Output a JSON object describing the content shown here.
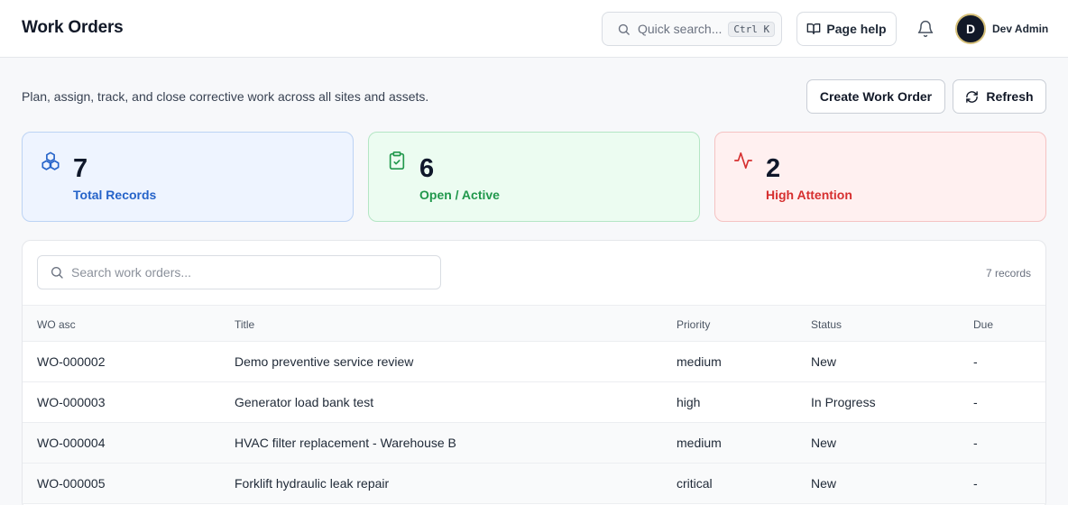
{
  "header": {
    "title": "Work Orders",
    "quick_search": {
      "placeholder": "Quick search...",
      "shortcut": "Ctrl K",
      "icon": "search-icon"
    },
    "help_label": "Page help",
    "help_icon": "book-open-icon",
    "notifications_icon": "bell-icon",
    "user": {
      "initial": "D",
      "name": "Dev Admin"
    }
  },
  "page": {
    "subtitle": "Plan, assign, track, and close corrective work across all sites and assets.",
    "create_label": "Create Work Order",
    "refresh_label": "Refresh",
    "refresh_icon": "refresh-icon"
  },
  "stats": [
    {
      "value": "7",
      "label": "Total Records",
      "icon": "boxes-icon",
      "color": "#2563c9"
    },
    {
      "value": "6",
      "label": "Open / Active",
      "icon": "clipboard-check-icon",
      "color": "#21984c"
    },
    {
      "value": "2",
      "label": "High Attention",
      "icon": "activity-icon",
      "color": "#d62f2f"
    }
  ],
  "table": {
    "search_placeholder": "Search work orders...",
    "record_count": "7 records",
    "columns": [
      "WO asc",
      "Title",
      "Priority",
      "Status",
      "Due"
    ],
    "rows": [
      {
        "wo": "WO-000002",
        "title": "Demo preventive service review",
        "priority": "medium",
        "status": "New",
        "due": "-"
      },
      {
        "wo": "WO-000003",
        "title": "Generator load bank test",
        "priority": "high",
        "status": "In Progress",
        "due": "-"
      },
      {
        "wo": "WO-000004",
        "title": "HVAC filter replacement - Warehouse B",
        "priority": "medium",
        "status": "New",
        "due": "-"
      },
      {
        "wo": "WO-000005",
        "title": "Forklift hydraulic leak repair",
        "priority": "critical",
        "status": "New",
        "due": "-"
      }
    ]
  }
}
